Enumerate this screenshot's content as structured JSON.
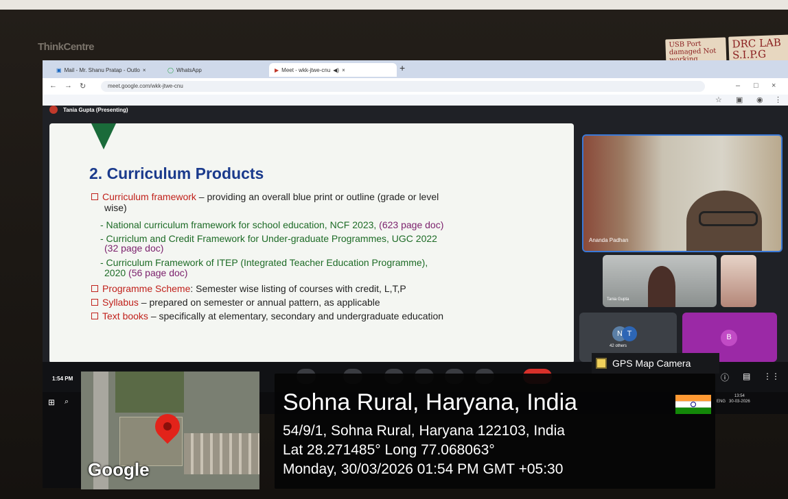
{
  "monitor": {
    "brand": "ThinkCentre",
    "sticky_note_1": "USB Port damaged Not working",
    "sticky_note_2": "DRC LAB S.I.P.G"
  },
  "browser": {
    "tabs": [
      {
        "label": "Mail - Mr. Shanu Pratap - Outlo"
      },
      {
        "label": "WhatsApp"
      },
      {
        "label": "Meet - wkk-jtwe-cnu"
      }
    ],
    "url": "meet.google.com/wkk-jtwe-cnu"
  },
  "meet": {
    "presenter": "Tania Gupta (Presenting)",
    "time": "1:54 PM",
    "participants": {
      "main": "Ananda Padhan",
      "second": "Tania Gupta",
      "others_avatars": [
        "N",
        "T"
      ],
      "others_count": "42 others",
      "b_avatar": "B"
    }
  },
  "slide": {
    "title": "2. Curriculum Products",
    "items": [
      {
        "lead": "Curriculum framework",
        "rest": " – providing an overall blue print or outline (grade or level"
      },
      {
        "cont": "wise)"
      },
      {
        "sub": "- National curriculum framework for school education, NCF 2023, ",
        "note": "(623 page doc)"
      },
      {
        "sub": "- Curriclum and Credit Framework for Under-graduate Programmes, UGC 2022"
      },
      {
        "note": "(32 page doc)"
      },
      {
        "sub": "- Curriculum Framework of ITEP (Integrated Teacher Education Programme),"
      },
      {
        "sub": "2020 ",
        "note": "(56 page doc)"
      },
      {
        "lead": "Programme Scheme",
        "rest": ": Semester wise listing of courses with credit, L,T,P"
      },
      {
        "lead": "Syllabus",
        "rest": " – prepared on semester or annual pattern, as applicable"
      },
      {
        "lead": "Text books",
        "rest": " – specifically at elementary, secondary and undergraduate education"
      }
    ]
  },
  "gps": {
    "app_label": "GPS Map Camera",
    "title": "Sohna Rural, Haryana, India",
    "address": "54/9/1, Sohna Rural, Haryana 122103, India",
    "coords": "Lat 28.271485° Long 77.068063°",
    "datetime": "Monday, 30/03/2026 01:54 PM GMT +05:30",
    "map_logo": "Google"
  },
  "taskbar": {
    "lang": "ENG",
    "time": "13:54",
    "date": "30-03-2026"
  }
}
